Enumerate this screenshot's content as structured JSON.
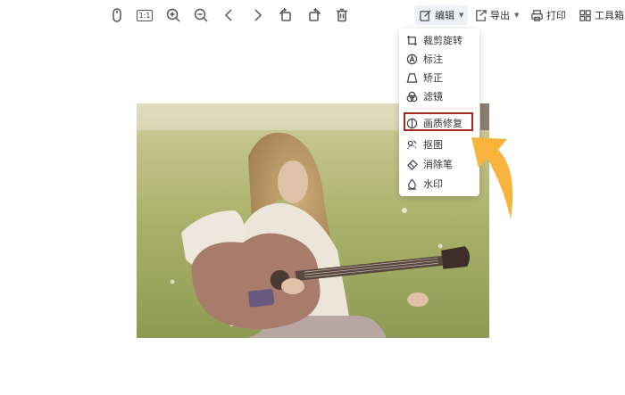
{
  "toolbar": {
    "edit_label": "编辑",
    "export_label": "导出",
    "print_label": "打印",
    "toolbox_label": "工具箱",
    "actual_size_label": "1:1",
    "icons": [
      "mouse-icon",
      "actual-size-icon",
      "zoom-in-icon",
      "zoom-out-icon",
      "prev-icon",
      "next-icon",
      "rotate-left-icon",
      "rotate-right-icon",
      "delete-icon",
      "edit-icon",
      "export-icon",
      "print-icon",
      "toolbox-icon"
    ]
  },
  "edit_menu": {
    "items": [
      {
        "label": "裁剪旋转",
        "icon": "crop-icon"
      },
      {
        "label": "标注",
        "icon": "annotate-icon"
      },
      {
        "label": "矫正",
        "icon": "correct-icon"
      },
      {
        "label": "滤镜",
        "icon": "filter-icon"
      },
      {
        "label": "画质修复",
        "icon": "restore-icon"
      },
      {
        "label": "抠图",
        "icon": "cutout-icon"
      },
      {
        "label": "消除笔",
        "icon": "eraser-icon"
      },
      {
        "label": "水印",
        "icon": "watermark-icon"
      }
    ],
    "highlighted": "画质修复"
  },
  "colors": {
    "highlight_border": "#a02a1e",
    "arrow": "#f7b33b"
  }
}
